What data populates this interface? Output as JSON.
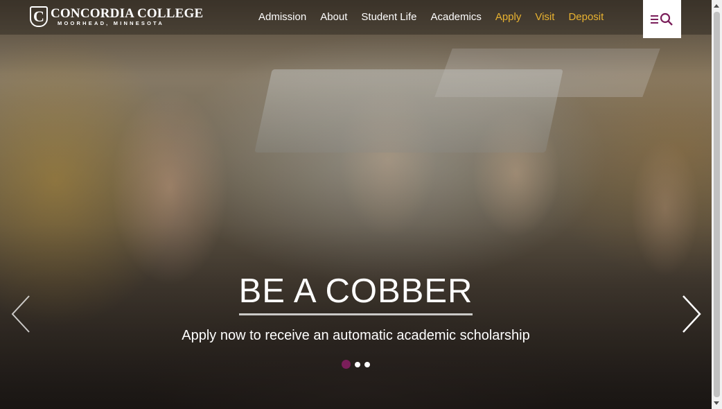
{
  "header": {
    "logo": {
      "name": "CONCORDIA COLLEGE",
      "location": "MOORHEAD, MINNESOTA",
      "mark": "C"
    },
    "nav": [
      {
        "label": "Admission",
        "highlight": false
      },
      {
        "label": "About",
        "highlight": false
      },
      {
        "label": "Student Life",
        "highlight": false
      },
      {
        "label": "Academics",
        "highlight": false
      },
      {
        "label": "Apply",
        "highlight": true
      },
      {
        "label": "Visit",
        "highlight": true
      },
      {
        "label": "Deposit",
        "highlight": true
      }
    ],
    "menu_icon": "menu-search-icon"
  },
  "hero": {
    "title": "BE A COBBER",
    "subtitle": "Apply now to receive an automatic academic scholarship",
    "slides": {
      "count": 3,
      "active": 1
    },
    "prev_icon": "chevron-left-icon",
    "next_icon": "chevron-right-icon"
  },
  "colors": {
    "accent_gold": "#e8b230",
    "active_dot": "#7a1e5a",
    "text": "#ffffff"
  }
}
